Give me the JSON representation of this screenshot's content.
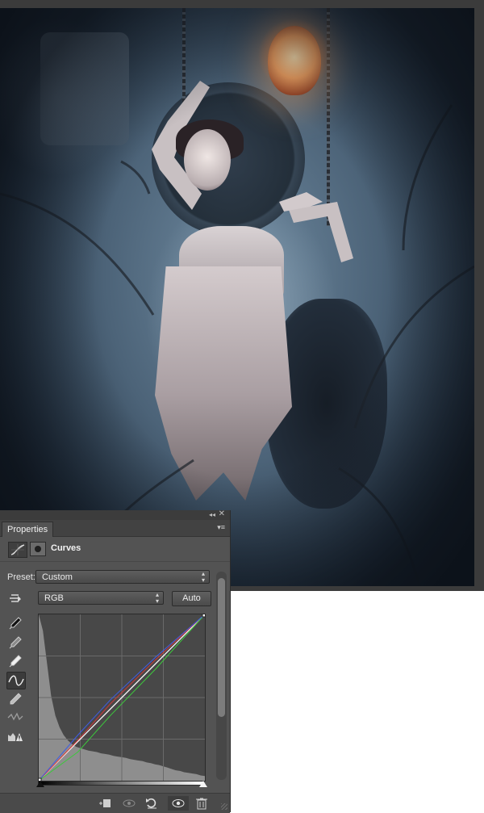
{
  "canvas": {
    "layers": [
      "ornament-relief",
      "round-medallion",
      "wall-hole",
      "chains",
      "glowing-lantern",
      "woman-figure",
      "tattered-dress",
      "bare-branches",
      "vignette"
    ]
  },
  "panel": {
    "tab_label": "Properties",
    "collapse_glyph": "◂◂",
    "close_glyph": "✕",
    "menu_glyph": "▾≡",
    "header": {
      "adjustment_icon": "curves-adjustment-icon",
      "mask_icon": "layer-mask-icon",
      "title": "Curves"
    },
    "preset": {
      "label": "Preset:",
      "value": "Custom"
    },
    "channel": {
      "value": "RGB"
    },
    "auto_label": "Auto",
    "tools": [
      {
        "name": "on-image-adjust-icon",
        "active": false
      },
      {
        "name": "black-point-eyedropper-icon",
        "active": false
      },
      {
        "name": "gray-point-eyedropper-icon",
        "active": false
      },
      {
        "name": "white-point-eyedropper-icon",
        "active": false
      },
      {
        "name": "edit-points-curve-icon",
        "active": true
      },
      {
        "name": "draw-pencil-icon",
        "active": false
      },
      {
        "name": "smooth-curve-icon",
        "active": false
      },
      {
        "name": "clipping-warning-icon",
        "active": false
      }
    ],
    "bottom_buttons": [
      "clip-to-layer-icon",
      "view-previous-state-icon",
      "reset-adjustments-icon",
      "toggle-visibility-icon",
      "delete-adjustment-icon"
    ]
  },
  "chart_data": {
    "type": "line",
    "title": "",
    "xlim": [
      0,
      255
    ],
    "ylim": [
      0,
      255
    ],
    "grid": true,
    "grid_divisions": 4,
    "colors": {
      "composite": "#ffffff",
      "red": "#d23838",
      "green": "#3cc83c",
      "blue": "#3f5ce6",
      "histogram": "#8e8e8e"
    },
    "histogram": [
      255,
      230,
      180,
      130,
      100,
      82,
      70,
      62,
      56,
      52,
      50,
      48,
      46,
      45,
      44,
      42,
      41,
      40,
      38,
      37,
      36,
      35,
      33,
      32,
      31,
      30,
      28,
      27,
      25,
      24,
      22,
      20,
      18,
      16,
      15,
      13,
      12,
      11,
      10,
      8,
      7
    ],
    "series": [
      {
        "key": "composite",
        "points": [
          [
            0,
            0
          ],
          [
            255,
            255
          ]
        ]
      },
      {
        "key": "red",
        "points": [
          [
            0,
            0
          ],
          [
            60,
            62
          ],
          [
            110,
            118
          ],
          [
            180,
            186
          ],
          [
            255,
            255
          ]
        ]
      },
      {
        "key": "green",
        "points": [
          [
            0,
            0
          ],
          [
            60,
            44
          ],
          [
            110,
            100
          ],
          [
            180,
            172
          ],
          [
            255,
            255
          ]
        ]
      },
      {
        "key": "blue",
        "points": [
          [
            0,
            0
          ],
          [
            60,
            70
          ],
          [
            110,
            124
          ],
          [
            180,
            190
          ],
          [
            255,
            255
          ]
        ]
      }
    ],
    "control_points": [
      [
        0,
        0
      ],
      [
        255,
        255
      ]
    ]
  }
}
